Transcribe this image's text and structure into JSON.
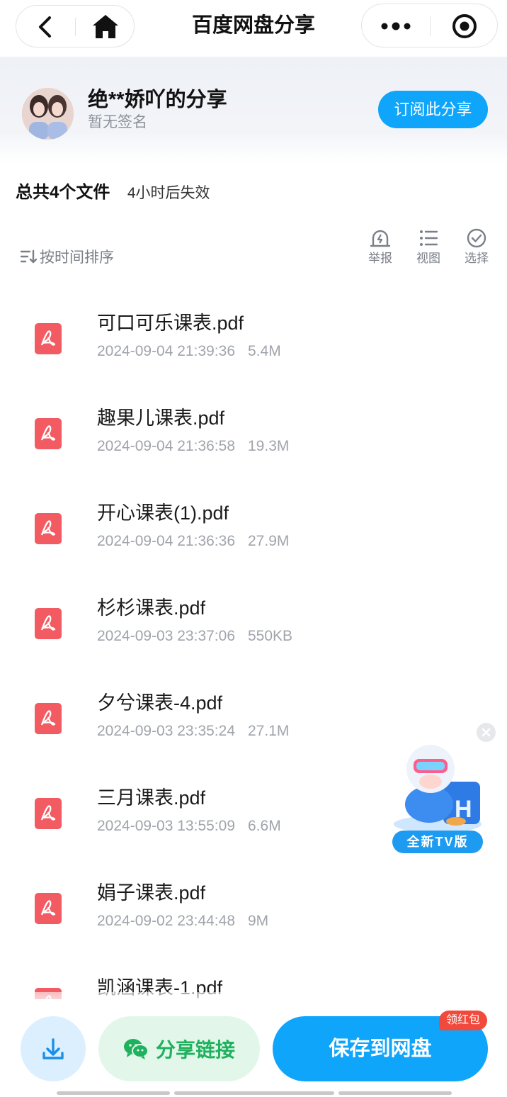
{
  "nav": {
    "title": "百度网盘分享",
    "back_icon": "chevron-left-icon",
    "home_icon": "home-icon",
    "more_icon": "more-dots-icon",
    "target_icon": "record-target-icon"
  },
  "sharer": {
    "name": "绝**娇吖的分享",
    "signature": "暂无签名",
    "subscribe_label": "订阅此分享",
    "accent": "#0ea5fb"
  },
  "summary": {
    "count_label": "总共4个文件",
    "expire_label": "4小时后失效"
  },
  "toolbar": {
    "sort_label": "按时间排序",
    "report_label": "举报",
    "view_label": "视图",
    "select_label": "选择"
  },
  "files": [
    {
      "name": "可口可乐课表.pdf",
      "date": "2024-09-04 21:39:36",
      "size": "5.4M"
    },
    {
      "name": "趣果儿课表.pdf",
      "date": "2024-09-04 21:36:58",
      "size": "19.3M"
    },
    {
      "name": "开心课表(1).pdf",
      "date": "2024-09-04 21:36:36",
      "size": "27.9M"
    },
    {
      "name": "杉杉课表.pdf",
      "date": "2024-09-03 23:37:06",
      "size": "550KB"
    },
    {
      "name": "夕兮课表-4.pdf",
      "date": "2024-09-03 23:35:24",
      "size": "27.1M"
    },
    {
      "name": "三月课表.pdf",
      "date": "2024-09-03 13:55:09",
      "size": "6.6M"
    },
    {
      "name": "娟子课表.pdf",
      "date": "2024-09-02 23:44:48",
      "size": "9M"
    },
    {
      "name": "凯涵课表-1.pdf",
      "date": "",
      "size": ""
    }
  ],
  "promo": {
    "badge": "全新TV版"
  },
  "bottom": {
    "share_label": "分享链接",
    "save_label": "保存到网盘",
    "red_packet_label": "领红包",
    "save_color": "#0ea5fb",
    "share_color": "#1fb15e"
  }
}
